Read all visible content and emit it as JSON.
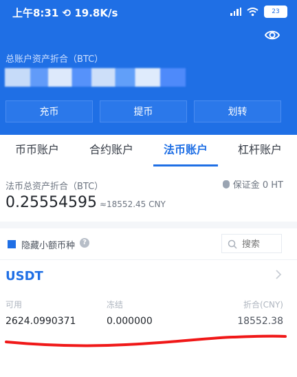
{
  "status": {
    "time": "上午8:31",
    "network_speed": "19.8K/s",
    "battery": "23",
    "signal_icon": "signal-icon",
    "wifi_icon": "wifi-icon"
  },
  "header": {
    "eye_icon": "eye-icon",
    "label": "总账户资产折合（BTC）",
    "actions": [
      "充币",
      "提币",
      "划转"
    ]
  },
  "tabs": [
    "币币账户",
    "合约账户",
    "法币账户",
    "杠杆账户"
  ],
  "summary": {
    "label": "法币总资产折合（BTC）",
    "margin": "保证金 0 HT",
    "btc_value": "0.25554595",
    "cny_value": "≈18552.45 CNY"
  },
  "filter": {
    "hide_small_label": "隐藏小额币种",
    "search_placeholder": "搜索",
    "help_icon": "question-icon"
  },
  "asset": {
    "name": "USDT",
    "labels": {
      "available": "可用",
      "frozen": "冻结",
      "converted": "折合(CNY)"
    },
    "values": {
      "available": "2624.0990371",
      "frozen": "0.000000",
      "converted": "18552.38"
    }
  },
  "colors": {
    "primary_blue": "#1f6fe5",
    "annotation_red": "#f01818"
  }
}
